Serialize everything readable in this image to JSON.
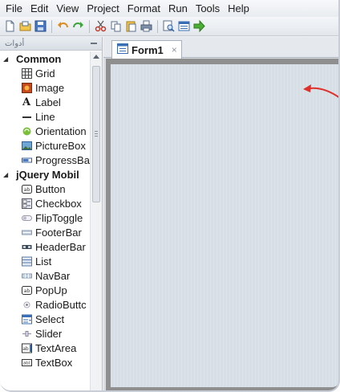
{
  "menu": [
    "File",
    "Edit",
    "View",
    "Project",
    "Format",
    "Run",
    "Tools",
    "Help"
  ],
  "toolbar_icons": [
    "new-file-icon",
    "open-file-icon",
    "save-icon",
    "undo-icon",
    "redo-icon",
    "cut-icon",
    "copy-icon",
    "paste-icon",
    "print-icon",
    "preview-icon",
    "form-icon",
    "run-icon"
  ],
  "panel": {
    "title": "أدوات"
  },
  "groups": [
    {
      "label": "Common",
      "items": [
        {
          "label": "Grid",
          "icon": "grid-icon"
        },
        {
          "label": "Image",
          "icon": "image-icon"
        },
        {
          "label": "Label",
          "icon": "label-icon"
        },
        {
          "label": "Line",
          "icon": "line-icon"
        },
        {
          "label": "Orientation",
          "icon": "orientation-icon"
        },
        {
          "label": "PictureBox",
          "icon": "picturebox-icon"
        },
        {
          "label": "ProgressBa",
          "icon": "progressbar-icon"
        }
      ]
    },
    {
      "label": "jQuery Mobil",
      "items": [
        {
          "label": "Button",
          "icon": "button-icon"
        },
        {
          "label": "Checkbox",
          "icon": "checkbox-icon"
        },
        {
          "label": "FlipToggle",
          "icon": "fliptoggle-icon"
        },
        {
          "label": "FooterBar",
          "icon": "footerbar-icon"
        },
        {
          "label": "HeaderBar",
          "icon": "headerbar-icon"
        },
        {
          "label": "List",
          "icon": "list-icon"
        },
        {
          "label": "NavBar",
          "icon": "navbar-icon"
        },
        {
          "label": "PopUp",
          "icon": "popup-icon"
        },
        {
          "label": "RadioButtc",
          "icon": "radiobutton-icon"
        },
        {
          "label": "Select",
          "icon": "select-icon"
        },
        {
          "label": "Slider",
          "icon": "slider-icon"
        },
        {
          "label": "TextArea",
          "icon": "textarea-icon"
        },
        {
          "label": "TextBox",
          "icon": "textbox-icon"
        }
      ]
    }
  ],
  "tab": {
    "label": "Form1",
    "close": "×"
  },
  "colors": {
    "canvas": "#d6dee6",
    "arrow": "#e0302a"
  }
}
